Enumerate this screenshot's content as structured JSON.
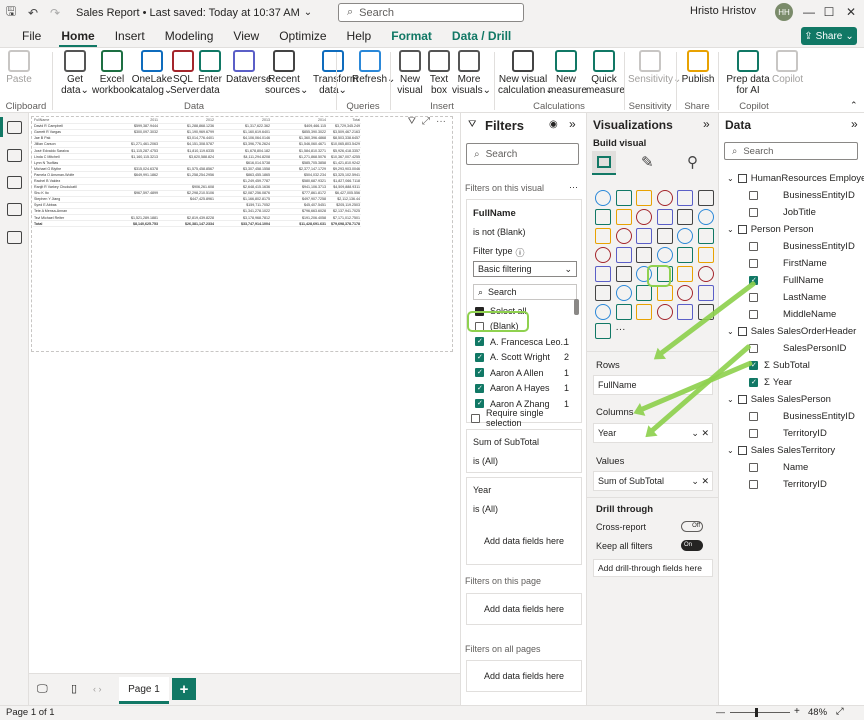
{
  "titlebar": {
    "title": "Sales Report • Last saved: Today at 10:37 AM",
    "title_caret": "⌄",
    "search_placeholder": "Search",
    "user_name": "Hristo Hristov",
    "avatar_initials": "HH"
  },
  "menu": {
    "tabs": [
      "File",
      "Home",
      "Insert",
      "Modeling",
      "View",
      "Optimize",
      "Help",
      "Format",
      "Data / Drill"
    ],
    "active": "Home",
    "share_label": "Share"
  },
  "ribbon": {
    "buttons": [
      {
        "label": "Paste",
        "disabled": true
      },
      {
        "label": "Get data",
        "caret": true
      },
      {
        "label": "Excel workbook"
      },
      {
        "label": "OneLake catalog",
        "caret": true
      },
      {
        "label": "SQL Server"
      },
      {
        "label": "Enter data"
      },
      {
        "label": "Dataverse"
      },
      {
        "label": "Recent sources",
        "caret": true
      },
      {
        "label": "Transform data",
        "caret": true
      },
      {
        "label": "Refresh",
        "caret": true
      },
      {
        "label": "New visual"
      },
      {
        "label": "Text box"
      },
      {
        "label": "More visuals",
        "caret": true
      },
      {
        "label": "New visual calculation",
        "caret": true
      },
      {
        "label": "New measure"
      },
      {
        "label": "Quick measure"
      },
      {
        "label": "Sensitivity",
        "caret": true,
        "disabled": true
      },
      {
        "label": "Publish"
      },
      {
        "label": "Prep data for AI"
      },
      {
        "label": "Copilot",
        "disabled": true
      }
    ],
    "groups": [
      "Clipboard",
      "Data",
      "Queries",
      "Insert",
      "Calculations",
      "Sensitivity",
      "Share",
      "Copilot"
    ]
  },
  "matrix": {
    "headers": [
      "FullName",
      "2011",
      "2012",
      "2013",
      "2014",
      "Total"
    ],
    "rows": [
      [
        "David R Campbell",
        "$599,387.9444",
        "$1,288,868.1236",
        "$1,317,622.362",
        "$409,466.115",
        "$3,729,345.249"
      ],
      [
        "Garrett R Vargas",
        "$300,097.3032",
        "$1,190,969.6799",
        "$1,160,619.6401",
        "$855,390.3022",
        "$3,509,467.2163"
      ],
      [
        "Jae B Pak",
        "",
        "$3,014,776.4401",
        "$4,106,064.0146",
        "$1,360,396.4868",
        "$8,503,338.6457"
      ],
      [
        "Jillian Carson",
        "$1,271,461.2063",
        "$4,151,308.5787",
        "$3,396,776.2624",
        "$1,546,060.4671",
        "$10,065,803.5429"
      ],
      [
        "José Edvaldo Saraiva",
        "$1,115,287.4753",
        "$1,810,119.6335",
        "$1,678,804.182",
        "$1,584,810.3271",
        "$5,926,418.3357"
      ],
      [
        "Linda C Mitchell",
        "$1,160,115.3213",
        "$3,620,588.824",
        "$4,111,294.8208",
        "$1,271,868.5076",
        "$10,367,007.4255"
      ],
      [
        "Lynn N Tsoflias",
        "",
        "",
        "$616,014.5738",
        "$585,705.3858",
        "$1,421,810.9242"
      ],
      [
        "Michael G Blythe",
        "$315,024.6378",
        "$1,575,458.8567",
        "$3,307,458.1558",
        "$2,377,147.1729",
        "$9,293,903.0046"
      ],
      [
        "Pamela O Ansman-Wolfe",
        "$649,991.1862",
        "$1,258,254.2956",
        "$863,455.1865",
        "$504,032.234",
        "$3,325,102.5941"
      ],
      [
        "Rachel B Valdez",
        "",
        "",
        "$1,249,459.7787",
        "$580,687.9321",
        "$1,827,066.7118"
      ],
      [
        "Ranjit R Varkey Chudukatil",
        "",
        "$906,261.608",
        "$2,648,415.1636",
        "$941,106.3713",
        "$4,509,888.9311"
      ],
      [
        "Shu K Ito",
        "$967,597.4899",
        "$2,298,210.5106",
        "$2,087,256.0876",
        "$777,861.8172",
        "$6,427,005.556"
      ],
      [
        "Stephen Y Jiang",
        "",
        "$447,425.8961",
        "$1,166,802.8175",
        "$497,907.7258",
        "$2,112,136.44"
      ],
      [
        "Syed E Abbas",
        "",
        "",
        "$159,711.7052",
        "$45,407.5451",
        "$205,119.2503"
      ],
      [
        "Tete A Mensa-Annan",
        "",
        "",
        "$1,341,278.1022",
        "$796,663.6028",
        "$2,137,941.7025"
      ],
      [
        "Tsvi Michael Reiter",
        "$1,521,289.1881",
        "$2,819,439.8228",
        "$3,178,968.7812",
        "$191,206.4058",
        "$7,171,012.7501"
      ]
    ],
    "total": [
      "Total",
      "$8,140,625.753",
      "$26,381,147.2334",
      "$33,747,914.1004",
      "$11,428,691.631",
      "$79,698,378.7178"
    ]
  },
  "filters": {
    "title": "Filters",
    "search_placeholder": "Search",
    "on_visual": "Filters on this visual",
    "fullname_card": {
      "field": "FullName",
      "condition": "is not (Blank)",
      "filter_type_label": "Filter type",
      "filter_type_value": "Basic filtering",
      "search_placeholder": "Search",
      "select_all": "Select all",
      "require_single": "Require single selection"
    },
    "list": [
      {
        "label": "(Blank)",
        "count": "",
        "checked": false
      },
      {
        "label": "A. Francesca Leo...",
        "count": "1",
        "checked": true
      },
      {
        "label": "A. Scott Wright",
        "count": "2",
        "checked": true
      },
      {
        "label": "Aaron A Allen",
        "count": "1",
        "checked": true
      },
      {
        "label": "Aaron A Hayes",
        "count": "1",
        "checked": true
      },
      {
        "label": "Aaron A Zhang",
        "count": "1",
        "checked": true
      }
    ],
    "subtotal_card": {
      "field": "Sum of SubTotal",
      "condition": "is (All)"
    },
    "year_card": {
      "field": "Year",
      "condition": "is (All)"
    },
    "add_fields": "Add data fields here",
    "on_page": "Filters on this page",
    "on_all": "Filters on all pages"
  },
  "viz": {
    "title": "Visualizations",
    "build": "Build visual",
    "rows_label": "Rows",
    "rows_field": "FullName",
    "columns_label": "Columns",
    "columns_field": "Year",
    "values_label": "Values",
    "values_field": "Sum of SubTotal",
    "drill": "Drill through",
    "cross_report": "Cross-report",
    "cross_state": "Off",
    "keep_filters": "Keep all filters",
    "keep_state": "On",
    "add_drill": "Add drill-through fields here",
    "more": "···"
  },
  "data": {
    "title": "Data",
    "search_placeholder": "Search",
    "tables": [
      {
        "name": "HumanResources Employee",
        "fields": [
          {
            "name": "BusinessEntityID",
            "checked": false
          },
          {
            "name": "JobTitle",
            "checked": false
          }
        ]
      },
      {
        "name": "Person Person",
        "fields": [
          {
            "name": "BusinessEntityID",
            "checked": false
          },
          {
            "name": "FirstName",
            "checked": false
          },
          {
            "name": "FullName",
            "checked": true
          },
          {
            "name": "LastName",
            "checked": false
          },
          {
            "name": "MiddleName",
            "checked": false
          }
        ]
      },
      {
        "name": "Sales SalesOrderHeader",
        "fields": [
          {
            "name": "SalesPersonID",
            "checked": false
          },
          {
            "name": "SubTotal",
            "checked": true,
            "sigma": true
          },
          {
            "name": "Year",
            "checked": true,
            "sigma": true
          }
        ]
      },
      {
        "name": "Sales SalesPerson",
        "fields": [
          {
            "name": "BusinessEntityID",
            "checked": false
          },
          {
            "name": "TerritoryID",
            "checked": false
          }
        ]
      },
      {
        "name": "Sales SalesTerritory",
        "fields": [
          {
            "name": "Name",
            "checked": false
          },
          {
            "name": "TerritoryID",
            "checked": false
          }
        ]
      }
    ]
  },
  "pages": {
    "current": "Page 1",
    "add": "+"
  },
  "status": {
    "page_info": "Page 1 of 1",
    "zoom": "48%"
  },
  "colors": {
    "accent": "#117865",
    "highlight": "#8fd14f"
  }
}
